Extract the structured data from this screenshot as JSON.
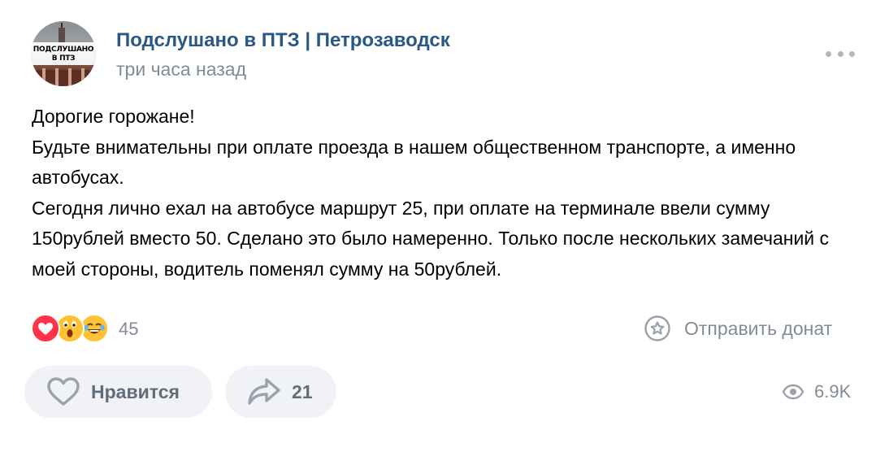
{
  "post": {
    "author": {
      "name": "Подслушано в ПТЗ | Петрозаводск",
      "avatar_text_line1": "ПОДСЛУШАНО",
      "avatar_text_line2": "В ПТЗ"
    },
    "time": "три часа назад",
    "more_icon": "more-horizontal-icon",
    "text_lines": [
      "Дорогие горожане!",
      "Будьте внимательны при оплате проезда в нашем общественном транспорте, а именно автобусах.",
      "Сегодня лично ехал на автобусе маршрут 25, при оплате на терминале ввели сумму 150рублей вместо 50. Сделано это было намеренно. Только после нескольких замечаний с моей стороны, водитель поменял сумму на 50рублей."
    ],
    "reactions": {
      "icons": [
        "heart-reaction-icon",
        "wow-reaction-icon",
        "laugh-reaction-icon"
      ],
      "count": "45"
    },
    "donate": {
      "icon": "donate-star-icon",
      "label": "Отправить донат"
    },
    "actions": {
      "like": {
        "icon": "heart-outline-icon",
        "label": "Нравится"
      },
      "share": {
        "icon": "share-arrow-icon",
        "count": "21"
      }
    },
    "views": {
      "icon": "eye-icon",
      "count": "6.9K"
    }
  },
  "colors": {
    "link": "#2a5885",
    "secondary": "#818c99",
    "button_bg": "#f0f2f5",
    "heart": "#ff3347",
    "emoji": "#ffc233"
  }
}
